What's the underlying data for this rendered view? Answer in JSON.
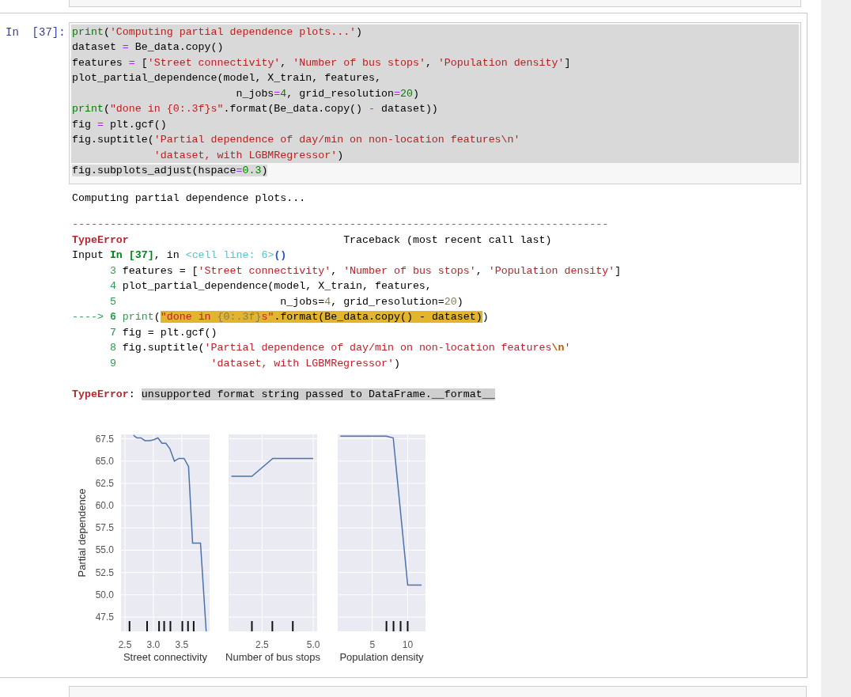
{
  "cell": {
    "prompt": "In  [37]:",
    "code": [
      {
        "kind": "selected-line",
        "tokens": [
          {
            "t": "print",
            "kind": "builtin"
          },
          {
            "t": "(",
            "kind": "plain"
          },
          {
            "t": "'Computing partial dependence plots...'",
            "kind": "string"
          },
          {
            "t": ")",
            "kind": "plain"
          }
        ]
      },
      {
        "kind": "selected-line",
        "tokens": [
          {
            "t": "dataset ",
            "kind": "plain"
          },
          {
            "t": "=",
            "kind": "op"
          },
          {
            "t": " Be_data.copy()",
            "kind": "plain"
          }
        ]
      },
      {
        "kind": "selected-line",
        "tokens": [
          {
            "t": "features ",
            "kind": "plain"
          },
          {
            "t": "=",
            "kind": "op"
          },
          {
            "t": " [",
            "kind": "plain"
          },
          {
            "t": "'Street connectivity'",
            "kind": "string"
          },
          {
            "t": ", ",
            "kind": "plain"
          },
          {
            "t": "'Number of bus stops'",
            "kind": "string"
          },
          {
            "t": ", ",
            "kind": "plain"
          },
          {
            "t": "'Population density'",
            "kind": "string"
          },
          {
            "t": "]",
            "kind": "plain"
          }
        ]
      },
      {
        "kind": "selected-line",
        "tokens": [
          {
            "t": "plot_partial_dependence(model, X_train, features,",
            "kind": "plain"
          }
        ]
      },
      {
        "kind": "selected-line",
        "tokens": [
          {
            "t": "                          n_jobs",
            "kind": "plain"
          },
          {
            "t": "=",
            "kind": "op"
          },
          {
            "t": "4",
            "kind": "num"
          },
          {
            "t": ", grid_resolution",
            "kind": "plain"
          },
          {
            "t": "=",
            "kind": "op"
          },
          {
            "t": "20",
            "kind": "num"
          },
          {
            "t": ")",
            "kind": "plain"
          }
        ]
      },
      {
        "kind": "selected-line",
        "tokens": [
          {
            "t": "print",
            "kind": "builtin"
          },
          {
            "t": "(",
            "kind": "plain"
          },
          {
            "t": "\"done in {0:.3f}s\"",
            "kind": "string"
          },
          {
            "t": ".format(Be_data.copy() ",
            "kind": "plain"
          },
          {
            "t": "-",
            "kind": "op"
          },
          {
            "t": " dataset))",
            "kind": "plain"
          }
        ]
      },
      {
        "kind": "selected-line",
        "tokens": [
          {
            "t": "fig ",
            "kind": "plain"
          },
          {
            "t": "=",
            "kind": "op"
          },
          {
            "t": " plt.gcf()",
            "kind": "plain"
          }
        ]
      },
      {
        "kind": "selected-line",
        "tokens": [
          {
            "t": "fig.suptitle(",
            "kind": "plain"
          },
          {
            "t": "'Partial dependence of day/min on non-location features\\n'",
            "kind": "string"
          }
        ]
      },
      {
        "kind": "selected-line",
        "tokens": [
          {
            "t": "             'dataset, with LGBMRegressor'",
            "kind": "string"
          },
          {
            "t": ")",
            "kind": "plain"
          }
        ]
      },
      {
        "kind": "selected-text",
        "tokens": [
          {
            "t": "fig.subplots_adjust(hspace",
            "kind": "plain"
          },
          {
            "t": "=",
            "kind": "op"
          },
          {
            "t": "0.3",
            "kind": "num"
          },
          {
            "t": ")",
            "kind": "plain"
          }
        ]
      }
    ],
    "stdout": "Computing partial dependence plots...",
    "traceback": [
      [
        {
          "t": "-------------------------------------------------------------------------------------",
          "kind": "dash"
        }
      ],
      [
        {
          "t": "TypeError",
          "kind": "ename"
        },
        {
          "t": "                                  Traceback (most recent call last)",
          "kind": "plain"
        }
      ],
      [
        {
          "t": "Input ",
          "kind": "plain"
        },
        {
          "t": "In [37]",
          "kind": "header"
        },
        {
          "t": ", in ",
          "kind": "plain"
        },
        {
          "t": "<cell line: 6>",
          "kind": "cellref"
        },
        {
          "t": "()",
          "kind": "paren"
        }
      ],
      [
        {
          "t": "      3",
          "kind": "lineno"
        },
        {
          "t": " features = [",
          "kind": "plain"
        },
        {
          "t": "'Street connectivity'",
          "kind": "string"
        },
        {
          "t": ", ",
          "kind": "plain"
        },
        {
          "t": "'Number of bus stops'",
          "kind": "string"
        },
        {
          "t": ", ",
          "kind": "plain"
        },
        {
          "t": "'Population density'",
          "kind": "string"
        },
        {
          "t": "]",
          "kind": "plain"
        }
      ],
      [
        {
          "t": "      4",
          "kind": "lineno"
        },
        {
          "t": " plot_partial_dependence(model, X_train, features,",
          "kind": "plain"
        }
      ],
      [
        {
          "t": "      5",
          "kind": "lineno"
        },
        {
          "t": "                          n_jobs=",
          "kind": "plain"
        },
        {
          "t": "4",
          "kind": "muted"
        },
        {
          "t": ", grid_resolution=",
          "kind": "plain"
        },
        {
          "t": "20",
          "kind": "muted"
        },
        {
          "t": ")",
          "kind": "plain"
        }
      ],
      [
        {
          "t": "----> ",
          "kind": "arrow"
        },
        {
          "t": "6 ",
          "kind": "current"
        },
        {
          "t": "print",
          "kind": "lineno"
        },
        {
          "t": "(",
          "kind": "plain"
        },
        {
          "t": "\"done in ",
          "kind": "string",
          "highlighted": true
        },
        {
          "t": "{0:.3f}",
          "kind": "muted",
          "highlighted": true
        },
        {
          "t": "s\"",
          "kind": "string",
          "highlighted": true
        },
        {
          "t": ".format(Be_data.copy() - dataset)",
          "kind": "plain",
          "highlighted": true
        },
        {
          "t": ")",
          "kind": "plain"
        }
      ],
      [
        {
          "t": "      7",
          "kind": "lineno"
        },
        {
          "t": " fig = plt.gcf()",
          "kind": "plain"
        }
      ],
      [
        {
          "t": "      8",
          "kind": "lineno"
        },
        {
          "t": " fig.suptitle(",
          "kind": "plain"
        },
        {
          "t": "'Partial dependence of day/min on non-location features",
          "kind": "string"
        },
        {
          "t": "\\n",
          "kind": "escape"
        },
        {
          "t": "'",
          "kind": "string"
        }
      ],
      [
        {
          "t": "      9",
          "kind": "lineno"
        },
        {
          "t": "               'dataset, with LGBMRegressor'",
          "kind": "string"
        },
        {
          "t": ")",
          "kind": "plain"
        }
      ]
    ],
    "error": {
      "name": "TypeError",
      "separator": ": ",
      "message": "unsupported format string passed to DataFrame.__format__"
    },
    "panels": [
      {
        "chart_data": {
          "type": "line",
          "grid": true,
          "xlabel": "Street connectivity",
          "ylabel": "Partial dependence",
          "x": [
            2.65,
            2.71,
            2.78,
            2.85,
            2.94,
            3.01,
            3.08,
            3.15,
            3.22,
            3.29,
            3.37,
            3.45,
            3.54,
            3.62,
            3.69,
            3.83,
            3.93
          ],
          "series": [
            {
              "color": "#4c72b0",
              "values": [
                67.9,
                67.6,
                67.6,
                67.3,
                67.3,
                67.4,
                67.6,
                67.0,
                67.0,
                66.4,
                65.0,
                65.3,
                65.3,
                64.4,
                55.8,
                55.8,
                45.9
              ]
            }
          ],
          "xlim": [
            2.43,
            3.99
          ],
          "ylim": [
            45.9,
            68.0
          ],
          "xticks": [
            {
              "value": 2.5,
              "label": "2.5"
            },
            {
              "value": 3.0,
              "label": "3.0"
            },
            {
              "value": 3.5,
              "label": "3.5"
            }
          ],
          "yticks": [
            {
              "value": 47.5,
              "label": "47.5"
            },
            {
              "value": 50,
              "label": "50.0"
            },
            {
              "value": 52.5,
              "label": "52.5"
            },
            {
              "value": 55,
              "label": "55.0"
            },
            {
              "value": 57.5,
              "label": "57.5"
            },
            {
              "value": 60,
              "label": "60.0"
            },
            {
              "value": 62.5,
              "label": "62.5"
            },
            {
              "value": 65,
              "label": "65.0"
            },
            {
              "value": 67.5,
              "label": "67.5"
            }
          ]
        }
      },
      {
        "chart_data": {
          "type": "line",
          "grid": true,
          "xlabel": "Number of bus stops",
          "x": [
            1.0,
            2.0,
            3.02,
            5.0
          ],
          "series": [
            {
              "color": "#4c72b0",
              "values": [
                63.3,
                63.3,
                65.3,
                65.3
              ]
            }
          ],
          "xlim": [
            0.86,
            5.19
          ],
          "ylim": [
            45.9,
            68.0
          ],
          "xticks": [
            {
              "value": 2.5,
              "label": "2.5"
            },
            {
              "value": 5.0,
              "label": "5.0"
            }
          ]
        }
      },
      {
        "chart_data": {
          "type": "line",
          "grid": true,
          "xlabel": "Population density",
          "x": [
            0.48,
            6.96,
            7.96,
            10.0,
            11.96
          ],
          "series": [
            {
              "color": "#4c72b0",
              "values": [
                67.8,
                67.8,
                67.6,
                51.1,
                51.1
              ]
            }
          ],
          "xlim": [
            0.11,
            12.52
          ],
          "ylim": [
            45.9,
            68.0
          ],
          "xticks": [
            {
              "value": 5,
              "label": "5"
            },
            {
              "value": 10,
              "label": "10"
            }
          ]
        }
      }
    ]
  }
}
